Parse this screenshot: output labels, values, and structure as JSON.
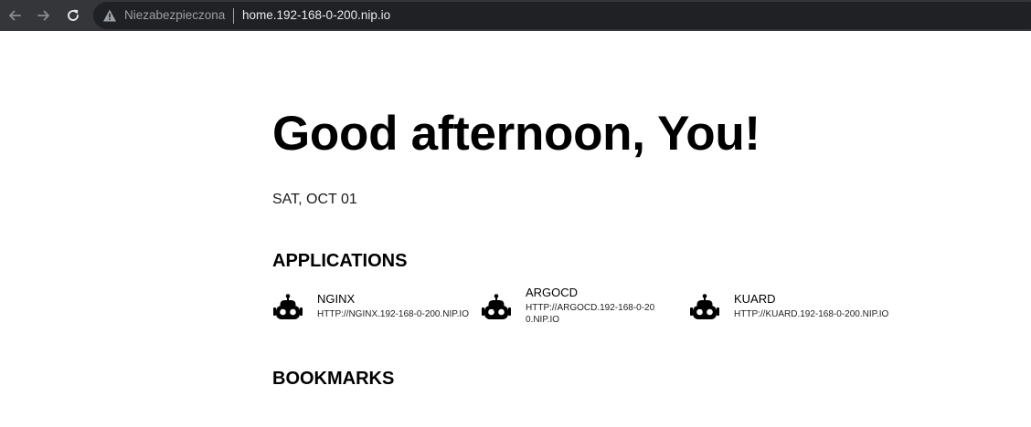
{
  "browser": {
    "security_label": "Niezabezpieczona",
    "url": "home.192-168-0-200.nip.io",
    "icons": {
      "back": "arrow-back-icon",
      "forward": "arrow-forward-icon",
      "reload": "reload-icon",
      "security": "warning-triangle-icon"
    },
    "colors": {
      "toolbar": "#35363a",
      "omnibox": "#202124",
      "text_muted": "#9aa0a6",
      "text": "#e8eaed"
    }
  },
  "page": {
    "greeting": "Good afternoon, You!",
    "date": "SAT, OCT 01",
    "applications_title": "APPLICATIONS",
    "bookmarks_title": "BOOKMARKS",
    "applications": [
      {
        "name": "NGINX",
        "url": "HTTP://NGINX.192-168-0-200.NIP.IO",
        "icon": "robot-icon"
      },
      {
        "name": "ARGOCD",
        "url": "HTTP://ARGOCD.192-168-0-200.NIP.IO",
        "icon": "robot-icon"
      },
      {
        "name": "KUARD",
        "url": "HTTP://KUARD.192-168-0-200.NIP.IO",
        "icon": "robot-icon"
      }
    ]
  }
}
